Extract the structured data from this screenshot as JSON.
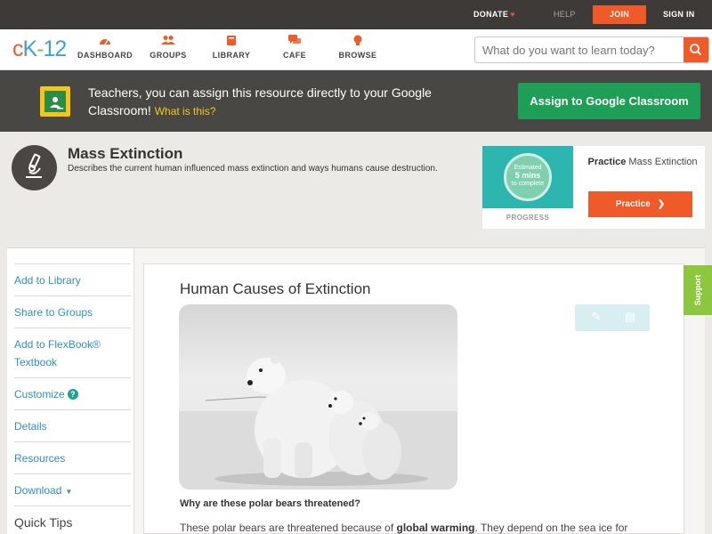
{
  "topbar": {
    "donate": "DONATE",
    "help": "HELP",
    "join": "JOIN",
    "signin": "SIGN IN"
  },
  "nav": {
    "logo": {
      "c": "c",
      "k": "K",
      "dash": "-",
      "n": "12"
    },
    "items": [
      {
        "label": "DASHBOARD",
        "icon": "dashboard-icon"
      },
      {
        "label": "GROUPS",
        "icon": "groups-icon"
      },
      {
        "label": "LIBRARY",
        "icon": "library-icon"
      },
      {
        "label": "CAFE",
        "icon": "cafe-icon"
      },
      {
        "label": "BROWSE",
        "icon": "browse-icon"
      }
    ],
    "search_placeholder": "What do you want to learn today?"
  },
  "google_banner": {
    "text": "Teachers, you can assign this resource directly to your Google Classroom!",
    "link": "What is this?",
    "button": "Assign to Google Classroom"
  },
  "concept": {
    "title": "Mass Extinction",
    "description": "Describes the current human influenced mass extinction and ways humans cause destruction."
  },
  "practice_card": {
    "estimate_line1": "Estimated",
    "estimate_line2": "5 mins",
    "estimate_line3": "to complete",
    "progress": "PROGRESS",
    "title_bold": "Practice",
    "title_rest": "Mass Extinction",
    "button": "Practice"
  },
  "sidebar": {
    "items": [
      "Add to Library",
      "Share to Groups",
      "Add to FlexBook® Textbook",
      "Customize",
      "Details",
      "Resources",
      "Download",
      "Quick Tips"
    ]
  },
  "content": {
    "title": "Human Causes of Extinction",
    "question": "Why are these polar bears threatened?",
    "body_start": "These polar bears are threatened because of ",
    "body_bold": "global warming",
    "body_end": ". They depend on the sea ice for"
  },
  "support": "Support",
  "colors": {
    "accent": "#f05a28",
    "link": "#2f8fbf",
    "google_green": "#1e9e57",
    "support_green": "#8dc63f"
  }
}
